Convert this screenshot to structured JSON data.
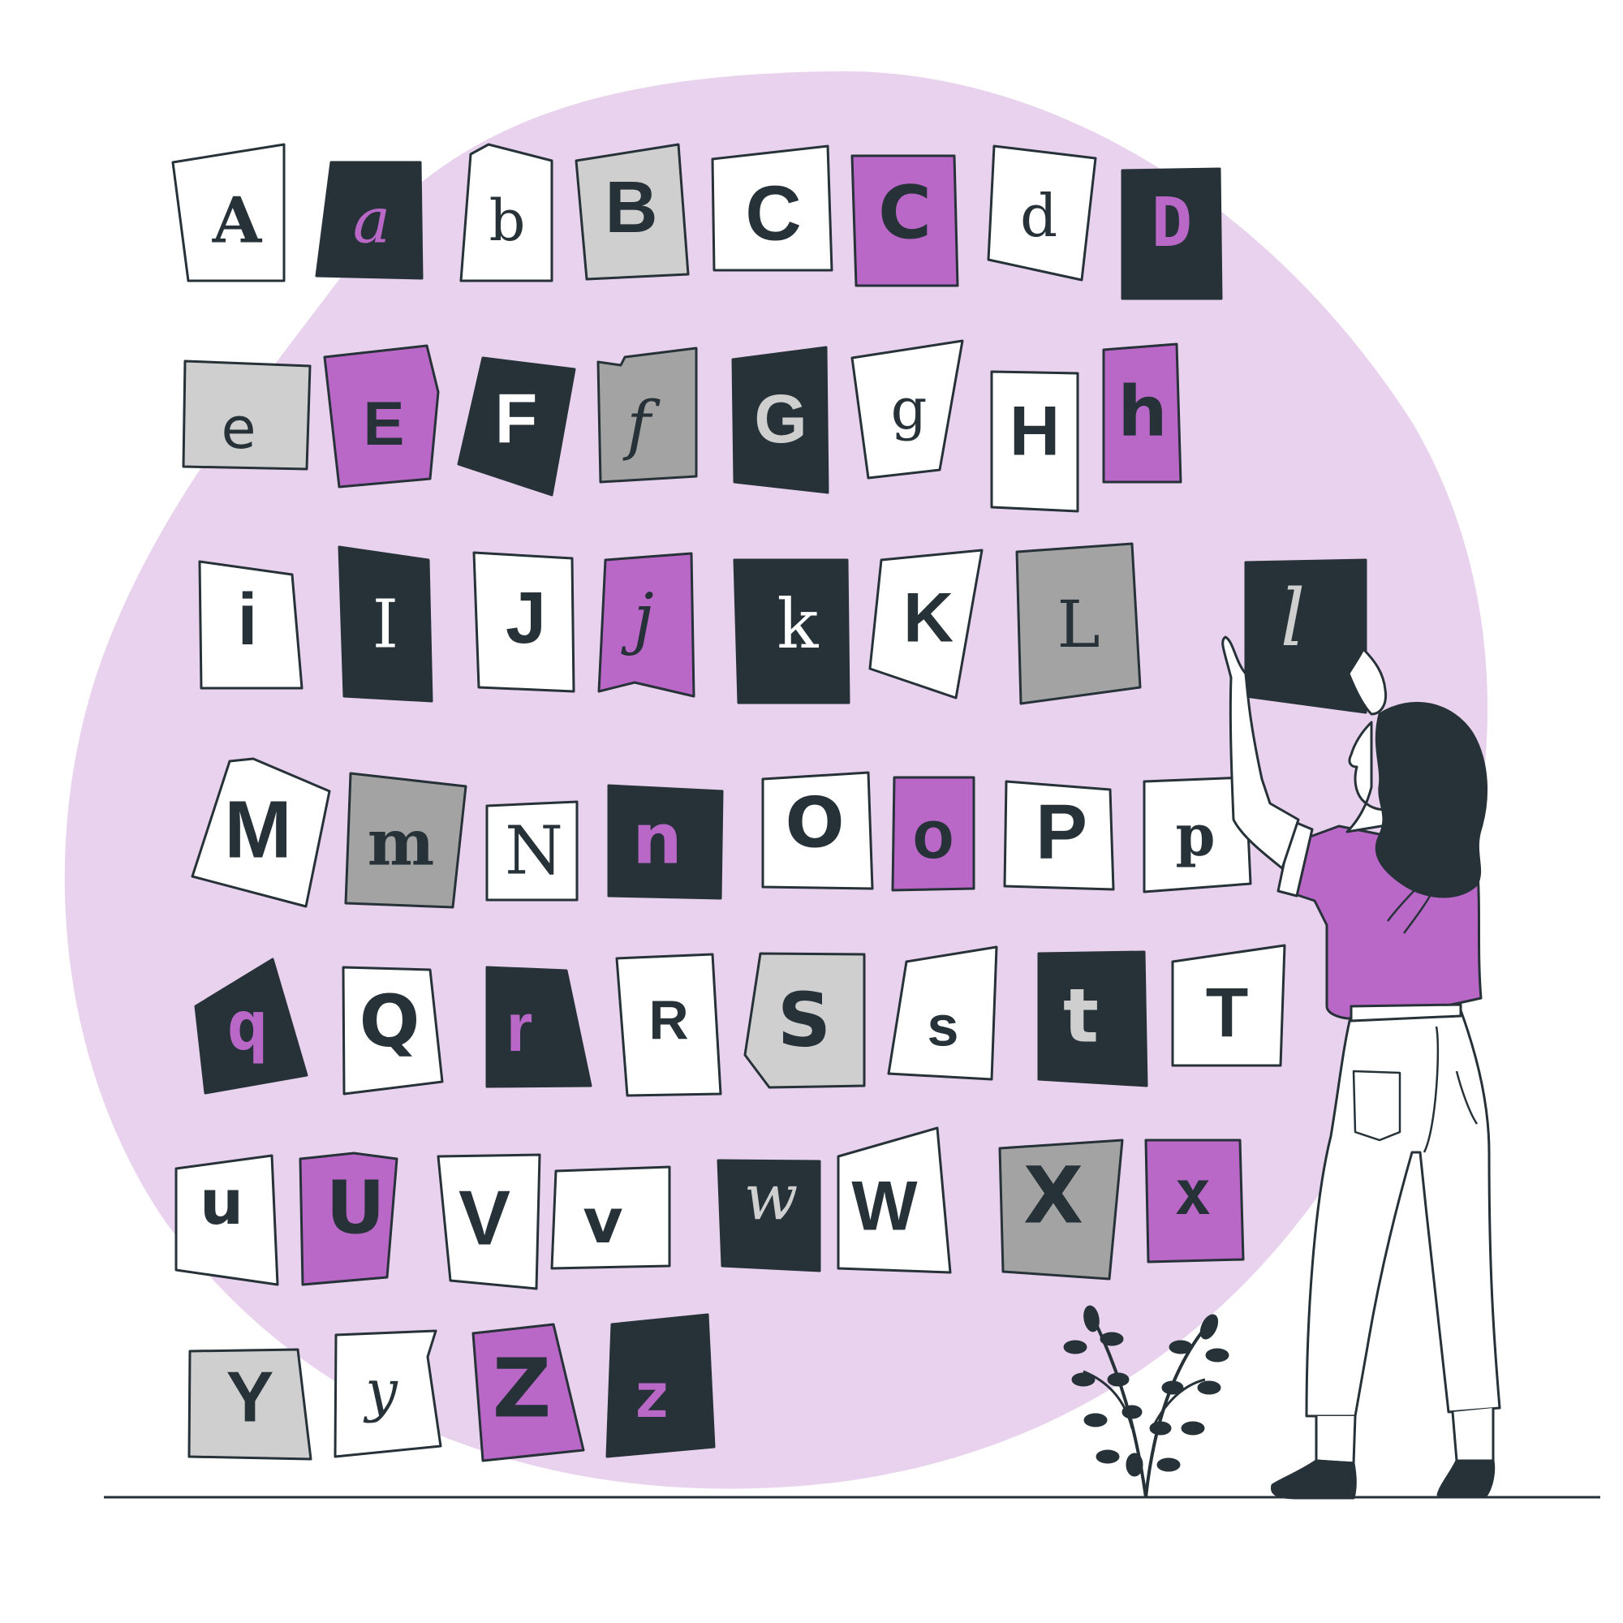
{
  "palette": {
    "blob": "#e8d2ee",
    "ink": "#263238",
    "white": "#ffffff",
    "purple": "#ba68c8",
    "light_gray": "#cfcfcf",
    "mid_gray": "#a3a3a3"
  },
  "letters": [
    {
      "ch": "A",
      "fill": "white",
      "color": "ink",
      "font": "serif-bold"
    },
    {
      "ch": "a",
      "fill": "ink",
      "color": "purple",
      "font": "serif-italic"
    },
    {
      "ch": "b",
      "fill": "white",
      "color": "ink",
      "font": "serif"
    },
    {
      "ch": "B",
      "fill": "light_gray",
      "color": "ink",
      "font": "sans-bold"
    },
    {
      "ch": "C",
      "fill": "white",
      "color": "ink",
      "font": "sans-bold"
    },
    {
      "ch": "C",
      "fill": "purple",
      "color": "ink",
      "font": "sans-cond"
    },
    {
      "ch": "d",
      "fill": "white",
      "color": "ink",
      "font": "serif"
    },
    {
      "ch": "D",
      "fill": "ink",
      "color": "purple",
      "font": "mono-bold"
    },
    {
      "ch": "e",
      "fill": "light_gray",
      "color": "ink",
      "font": "sans"
    },
    {
      "ch": "E",
      "fill": "purple",
      "color": "ink",
      "font": "sans-bold"
    },
    {
      "ch": "F",
      "fill": "ink",
      "color": "white",
      "font": "sans-bold"
    },
    {
      "ch": "f",
      "fill": "mid_gray",
      "color": "ink",
      "font": "serif-italic"
    },
    {
      "ch": "G",
      "fill": "ink",
      "color": "light_gray",
      "font": "sans-bold"
    },
    {
      "ch": "g",
      "fill": "white",
      "color": "ink",
      "font": "serif"
    },
    {
      "ch": "H",
      "fill": "white",
      "color": "ink",
      "font": "sans-bold"
    },
    {
      "ch": "h",
      "fill": "purple",
      "color": "ink",
      "font": "sans-cond"
    },
    {
      "ch": "i",
      "fill": "white",
      "color": "ink",
      "font": "sans-bold"
    },
    {
      "ch": "I",
      "fill": "ink",
      "color": "white",
      "font": "serif"
    },
    {
      "ch": "J",
      "fill": "white",
      "color": "ink",
      "font": "sans-bold"
    },
    {
      "ch": "j",
      "fill": "purple",
      "color": "ink",
      "font": "serif-italic"
    },
    {
      "ch": "k",
      "fill": "ink",
      "color": "white",
      "font": "serif"
    },
    {
      "ch": "K",
      "fill": "white",
      "color": "ink",
      "font": "sans-bold"
    },
    {
      "ch": "L",
      "fill": "mid_gray",
      "color": "ink",
      "font": "serif"
    },
    {
      "ch": "l",
      "fill": "ink",
      "color": "light_gray",
      "font": "serif-italic"
    },
    {
      "ch": "M",
      "fill": "white",
      "color": "ink",
      "font": "sans-bold"
    },
    {
      "ch": "m",
      "fill": "mid_gray",
      "color": "ink",
      "font": "serif-bold"
    },
    {
      "ch": "N",
      "fill": "white",
      "color": "ink",
      "font": "serif"
    },
    {
      "ch": "n",
      "fill": "ink",
      "color": "purple",
      "font": "sans-cond"
    },
    {
      "ch": "O",
      "fill": "white",
      "color": "ink",
      "font": "sans-cond"
    },
    {
      "ch": "o",
      "fill": "purple",
      "color": "ink",
      "font": "sans-bold"
    },
    {
      "ch": "P",
      "fill": "white",
      "color": "ink",
      "font": "sans-bold"
    },
    {
      "ch": "p",
      "fill": "white",
      "color": "ink",
      "font": "serif-bold"
    },
    {
      "ch": "q",
      "fill": "ink",
      "color": "purple",
      "font": "mono-bold"
    },
    {
      "ch": "Q",
      "fill": "white",
      "color": "ink",
      "font": "sans-cond"
    },
    {
      "ch": "r",
      "fill": "ink",
      "color": "purple",
      "font": "sans-bold"
    },
    {
      "ch": "R",
      "fill": "white",
      "color": "ink",
      "font": "sans-bold"
    },
    {
      "ch": "S",
      "fill": "light_gray",
      "color": "ink",
      "font": "sans-cond"
    },
    {
      "ch": "s",
      "fill": "white",
      "color": "ink",
      "font": "sans-bold"
    },
    {
      "ch": "t",
      "fill": "ink",
      "color": "light_gray",
      "font": "sans-cond"
    },
    {
      "ch": "T",
      "fill": "white",
      "color": "ink",
      "font": "sans-bold"
    },
    {
      "ch": "u",
      "fill": "white",
      "color": "ink",
      "font": "sans-cond"
    },
    {
      "ch": "U",
      "fill": "purple",
      "color": "ink",
      "font": "sans-cond"
    },
    {
      "ch": "V",
      "fill": "white",
      "color": "ink",
      "font": "sans-bold"
    },
    {
      "ch": "v",
      "fill": "white",
      "color": "ink",
      "font": "sans-cond"
    },
    {
      "ch": "w",
      "fill": "ink",
      "color": "light_gray",
      "font": "serif-italic"
    },
    {
      "ch": "W",
      "fill": "white",
      "color": "ink",
      "font": "sans-bold"
    },
    {
      "ch": "X",
      "fill": "mid_gray",
      "color": "ink",
      "font": "sans-cond"
    },
    {
      "ch": "x",
      "fill": "purple",
      "color": "ink",
      "font": "mono-bold"
    },
    {
      "ch": "Y",
      "fill": "light_gray",
      "color": "ink",
      "font": "sans-bold"
    },
    {
      "ch": "y",
      "fill": "white",
      "color": "ink",
      "font": "serif-italic"
    },
    {
      "ch": "Z",
      "fill": "purple",
      "color": "ink",
      "font": "sans-cond"
    },
    {
      "ch": "z",
      "fill": "ink",
      "color": "purple",
      "font": "mono-bold"
    }
  ]
}
